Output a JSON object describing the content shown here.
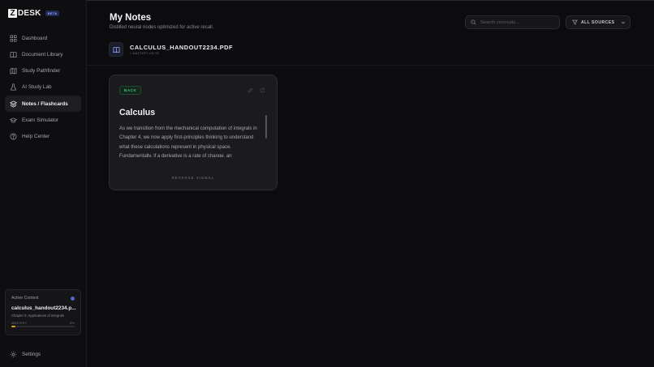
{
  "app": {
    "logo_mark": "Z",
    "logo_text": "DESK",
    "badge": "BETA"
  },
  "sidebar": {
    "items": [
      {
        "label": "Dashboard",
        "icon": "grid-icon"
      },
      {
        "label": "Document Library",
        "icon": "book-icon"
      },
      {
        "label": "Study Pathfinder",
        "icon": "map-icon"
      },
      {
        "label": "AI Study Lab",
        "icon": "flask-icon"
      },
      {
        "label": "Notes / Flashcards",
        "icon": "layers-icon",
        "active": true
      },
      {
        "label": "Exam Simulator",
        "icon": "graduation-cap-icon"
      },
      {
        "label": "Help Center",
        "icon": "help-circle-icon"
      }
    ],
    "context": {
      "label": "Active Context",
      "file": "calculus_handout2234.p...",
      "chapter": "Chapter 0: Applications of Integrals",
      "mastery_label": "MASTERY",
      "mastery_value": "6%",
      "mastery_fraction": 0.06
    },
    "settings_label": "Settings"
  },
  "header": {
    "title": "My Notes",
    "subtitle": "Distilled neural nodes optimized for active recall.",
    "search_placeholder": "Search concepts...",
    "sources_label": "ALL SOURCES"
  },
  "document": {
    "name": "CALCULUS_HANDOUT2234.PDF",
    "units": "1 MASTERY UNITS"
  },
  "card": {
    "side_badge": "BACK",
    "title": "Calculus",
    "body": "As we transition from the mechanical computation of integrals in Chapter 4, we now apply first-principles thinking to understand what these calculations represent in physical space. Fundamentally, if a derivative is a rate of change, an accumulation of rates yields a total quantity.",
    "footer": "REVERSE SIGNAL"
  },
  "colors": {
    "accent": "#5566c8",
    "badge_green": "#3fc07a",
    "mastery": "#d9a21b"
  }
}
